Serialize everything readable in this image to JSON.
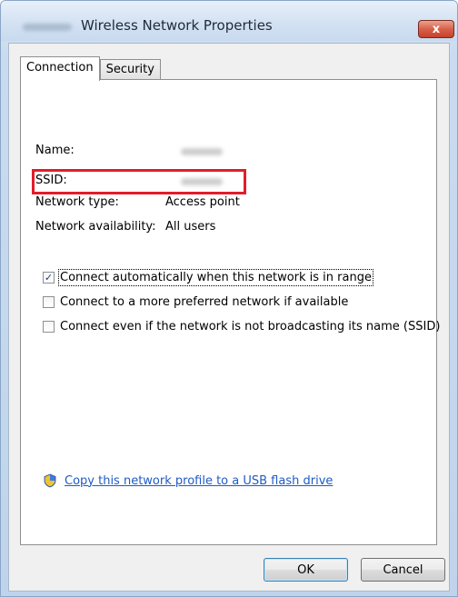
{
  "window": {
    "title": "Wireless Network Properties",
    "close_label": "x"
  },
  "tabs": [
    {
      "label": "Connection",
      "active": true
    },
    {
      "label": "Security",
      "active": false
    }
  ],
  "properties": {
    "name_label": "Name:",
    "ssid_label": "SSID:",
    "network_type_label": "Network type:",
    "network_type_value": "Access point",
    "availability_label": "Network availability:",
    "availability_value": "All users"
  },
  "options": [
    {
      "label": "Connect automatically when this network is in range",
      "checked": true
    },
    {
      "label": "Connect to a more preferred network if available",
      "checked": false
    },
    {
      "label": "Connect even if the network is not broadcasting its name (SSID)",
      "checked": false
    }
  ],
  "link": {
    "text": "Copy this network profile to a USB flash drive",
    "icon": "shield-icon"
  },
  "buttons": {
    "ok": "OK",
    "cancel": "Cancel"
  },
  "colors": {
    "highlight": "#e11d2a",
    "link": "#1e5bc6",
    "close": "#c8412b"
  }
}
